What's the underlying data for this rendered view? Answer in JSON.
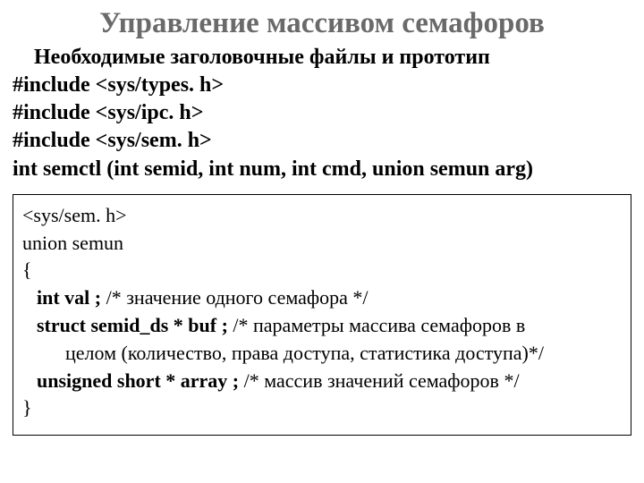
{
  "title": "Управление массивом семафоров",
  "subtitle": "Необходимые заголовочные файлы и прототип",
  "includes": {
    "l1": "#include <sys/types. h>",
    "l2": "#include <sys/ipc. h>",
    "l3": "#include <sys/sem. h>"
  },
  "prototype": "int semctl (int semid, int num, int cmd, union  semun arg)",
  "union": {
    "header": "<sys/sem. h>",
    "decl": "union semun",
    "open": "{",
    "val_decl": "int val ;",
    "val_comment": "  /* значение одного семафора */",
    "buf_decl": "struct semid_ds * buf ;",
    "buf_comment1": " /* параметры массива семафоров в",
    "buf_comment2": "целом  (количество, права доступа, статистика доступа)*/",
    "arr_decl": "unsigned short * array ;",
    "arr_comment": "    /* массив значений семафоров */",
    "close": "}"
  }
}
